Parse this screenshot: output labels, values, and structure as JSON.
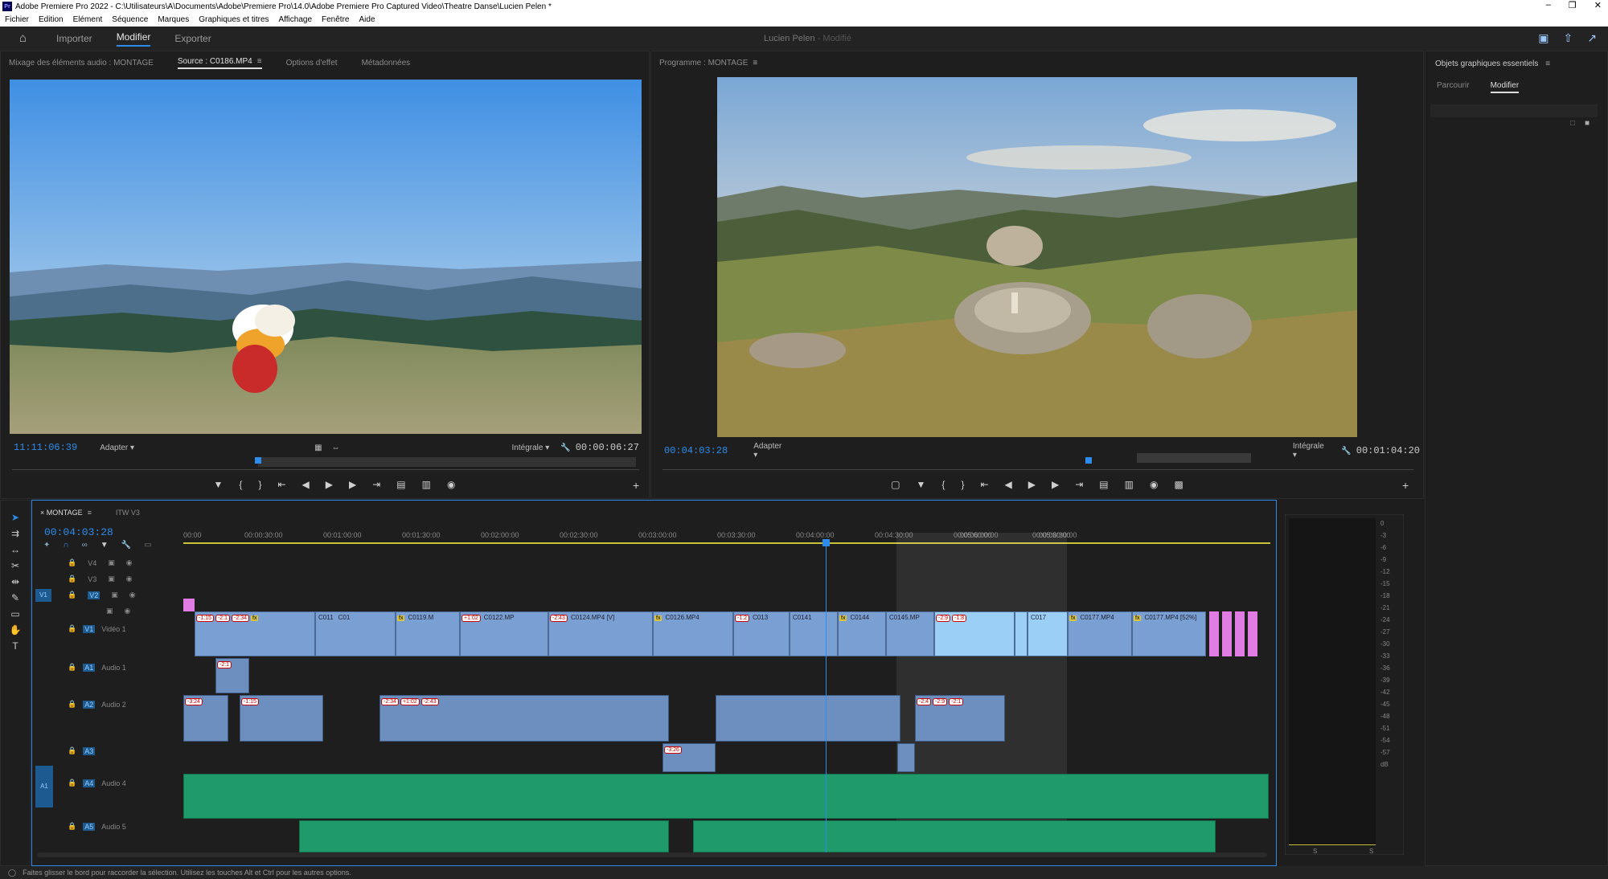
{
  "window": {
    "title": "Adobe Premiere Pro 2022 - C:\\Utilisateurs\\A\\Documents\\Adobe\\Premiere Pro\\14.0\\Adobe Premiere Pro Captured Video\\Theatre Danse\\Lucien Pelen *",
    "app_icon": "Pr"
  },
  "menu": [
    "Fichier",
    "Edition",
    "Elément",
    "Séquence",
    "Marques",
    "Graphiques et titres",
    "Affichage",
    "Fenêtre",
    "Aide"
  ],
  "workspace": {
    "tabs": [
      "Importer",
      "Modifier",
      "Exporter"
    ],
    "active_tab": "Modifier",
    "project_title": "Lucien Pelen",
    "project_state": "Modifié"
  },
  "source_panel": {
    "tabs": [
      "Mixage des éléments audio : MONTAGE",
      "Source : C0186.MP4",
      "Options d'effet",
      "Métadonnées"
    ],
    "active_tab": "Source : C0186.MP4",
    "timecode": "11:11:06:39",
    "zoom": "Adapter",
    "resolution": "Intégrale",
    "duration": "00:00:06:27"
  },
  "program_panel": {
    "title": "Programme : MONTAGE",
    "timecode": "00:04:03:28",
    "zoom": "Adapter",
    "resolution": "Intégrale",
    "duration": "00:01:04:20"
  },
  "essential_graphics": {
    "title": "Objets graphiques essentiels",
    "tabs": [
      "Parcourir",
      "Modifier"
    ],
    "active_tab": "Modifier"
  },
  "timeline": {
    "tabs": [
      "MONTAGE",
      "ITW V3"
    ],
    "timecode": "00:04:03:28",
    "ruler": [
      "00:00",
      "00:00:30:00",
      "00:01:00:00",
      "00:01:30:00",
      "00:02:00:00",
      "00:02:30:00",
      "00:03:00:00",
      "00:03:30:00",
      "00:04:00:00",
      "00:04:30:00",
      "00:05:00:00",
      "00:05:30:00",
      "00:06:00:00",
      "00:06:30:00"
    ],
    "video_tracks": [
      {
        "id": "V4",
        "name": ""
      },
      {
        "id": "V3",
        "name": ""
      },
      {
        "id": "V2",
        "name": ""
      },
      {
        "id": "V1",
        "name": "Vidéo 1"
      }
    ],
    "audio_tracks": [
      {
        "id": "A1",
        "name": "Audio 1"
      },
      {
        "id": "A2",
        "name": "Audio 2"
      },
      {
        "id": "A3",
        "name": ""
      },
      {
        "id": "A4",
        "name": "Audio 4"
      },
      {
        "id": "A5",
        "name": "Audio 5"
      }
    ],
    "source_patch_video": "V1",
    "source_patch_audio": "A1",
    "clip_labels": [
      "C011",
      "C01",
      "C0119.M",
      "C0122.MP",
      "C0124.MP4 [V]",
      "C0126.MP4",
      "C013",
      "C0141",
      "C0144",
      "C0145.MP",
      "C017",
      "C0177.MP4",
      "C0177.MP4 [52%]"
    ],
    "badges": [
      "-1:15",
      "-2:1",
      "-2:34",
      "+1:02",
      "-2:43",
      "-1:2",
      "-2:9",
      "-1:8",
      "-2:1",
      "-3:24",
      "-1:15",
      "-2:34",
      "+1:02",
      "-2:43",
      "-3:26",
      "-2:4",
      "-2:9",
      "-2:1"
    ]
  },
  "audio_meter": {
    "scale": [
      "0",
      "-3",
      "-6",
      "-9",
      "-12",
      "-15",
      "-18",
      "-21",
      "-24",
      "-27",
      "-30",
      "-33",
      "-36",
      "-39",
      "-42",
      "-45",
      "-48",
      "-51",
      "-54",
      "-57",
      "dB"
    ],
    "solo": [
      "S",
      "S"
    ]
  },
  "tools": [
    "selection-tool",
    "track-select-tool",
    "ripple-edit-tool",
    "razor-tool",
    "slip-tool",
    "pen-tool",
    "rectangle-tool",
    "hand-tool",
    "type-tool"
  ],
  "status_bar": "Faites glisser le bord pour raccorder la sélection. Utilisez les touches Alt et Ctrl pour les autres options.",
  "colors": {
    "accent": "#2d8ceb",
    "video_clip": "#7a9fd2",
    "video_clip_selected": "#9ccff5",
    "audio_clip": "#6c8fc0",
    "audio_clip_green": "#1f9a6b",
    "pink_clip": "#e07ce2",
    "playhead": "#2d8ceb"
  }
}
